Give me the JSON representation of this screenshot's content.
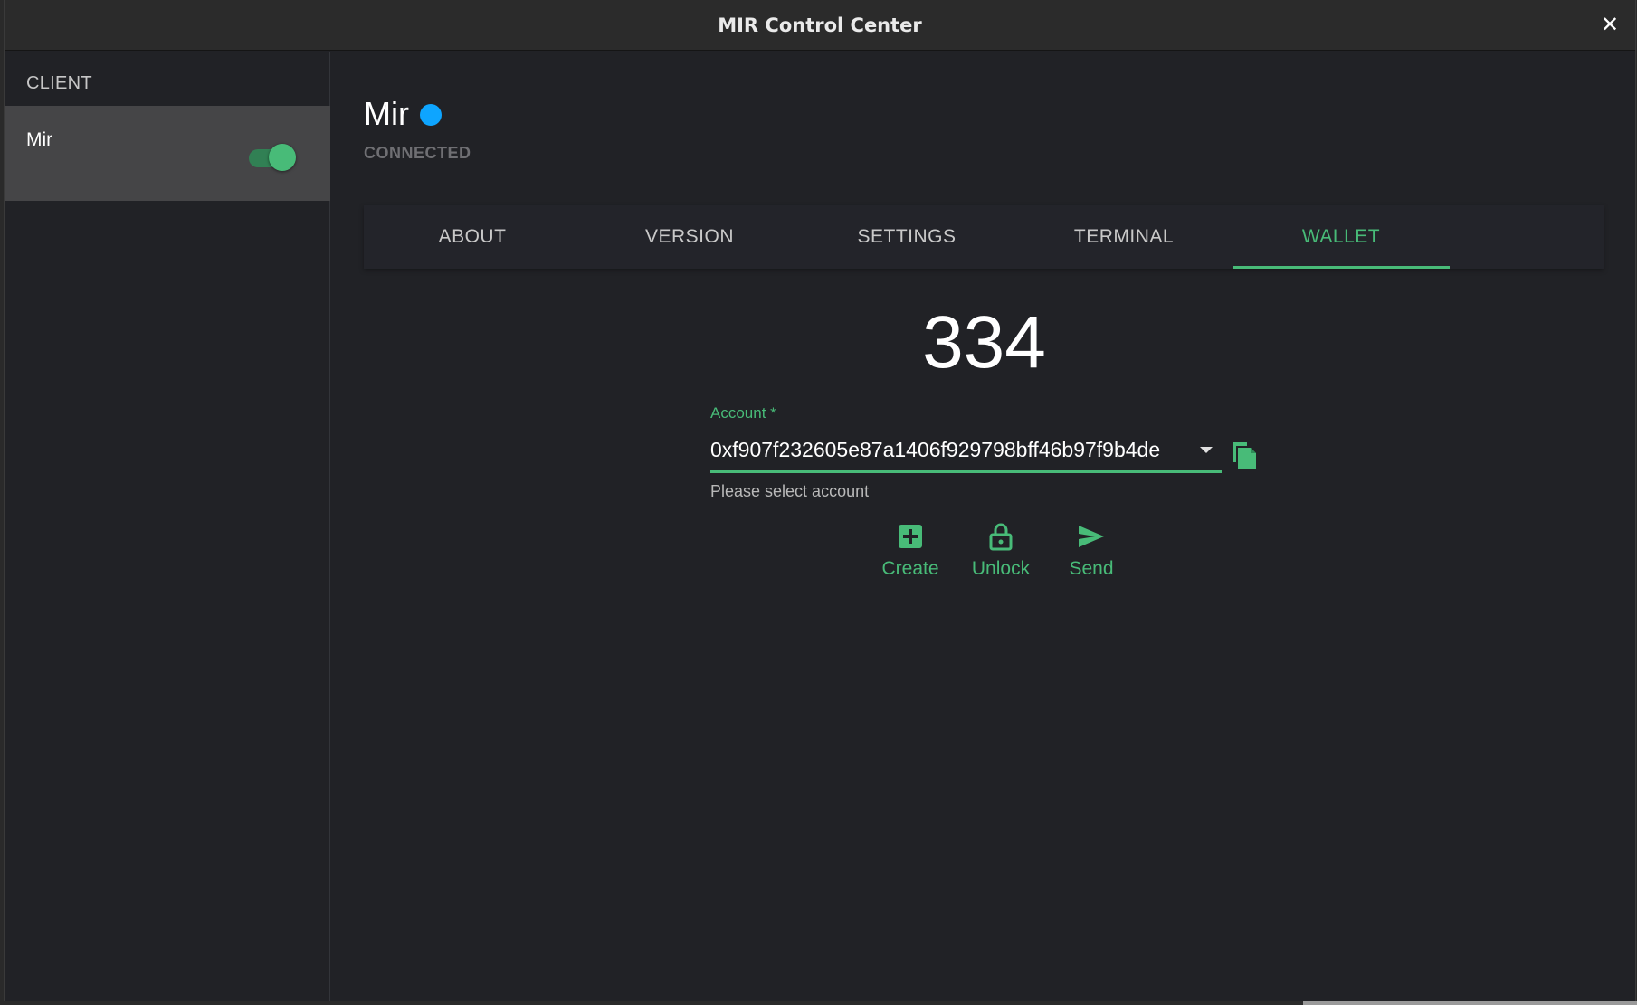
{
  "window": {
    "title": "MIR Control Center",
    "close_symbol": "✕"
  },
  "sidebar": {
    "section_label": "CLIENT",
    "clients": [
      {
        "name": "Mir",
        "enabled": true
      }
    ]
  },
  "client": {
    "name": "Mir",
    "status": "CONNECTED",
    "status_color": "#0ea5ff"
  },
  "tabs": [
    {
      "label": "ABOUT",
      "active": false
    },
    {
      "label": "VERSION",
      "active": false
    },
    {
      "label": "SETTINGS",
      "active": false
    },
    {
      "label": "TERMINAL",
      "active": false
    },
    {
      "label": "WALLET",
      "active": true
    }
  ],
  "wallet": {
    "balance": "334",
    "account_label": "Account *",
    "account_value": "0xf907f232605e87a1406f929798bff46b97f9b4de",
    "helper_text": "Please select account",
    "actions": [
      {
        "label": "Create",
        "icon": "plus-box-icon"
      },
      {
        "label": "Unlock",
        "icon": "unlock-icon"
      },
      {
        "label": "Send",
        "icon": "send-icon"
      }
    ]
  },
  "colors": {
    "accent": "#48bb78",
    "background": "#212226",
    "sidebar_selected": "#454547"
  }
}
